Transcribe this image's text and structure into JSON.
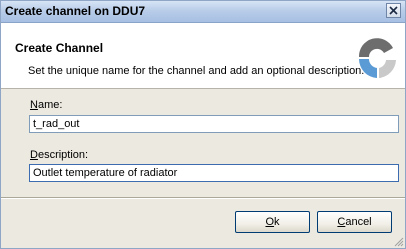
{
  "window": {
    "title": "Create channel on DDU7"
  },
  "header": {
    "title": "Create Channel",
    "description": "Set the unique name for the channel and add an optional description."
  },
  "form": {
    "name_label_accel": "N",
    "name_label_rest": "ame:",
    "name_value": "t_rad_out",
    "description_label_accel": "D",
    "description_label_rest": "escription:",
    "description_value": "Outlet temperature of radiator"
  },
  "buttons": {
    "ok_accel": "O",
    "ok_rest": "k",
    "cancel_accel": "C",
    "cancel_rest": "ancel"
  },
  "icons": {
    "close": "close-icon",
    "logo": "logo-icon",
    "grip": "resize-grip-icon"
  },
  "colors": {
    "titlebar": "#b9cde9",
    "logo_dark": "#6d6d6d",
    "logo_blue": "#5b9bd5",
    "focus_border": "#3c6bb0"
  }
}
